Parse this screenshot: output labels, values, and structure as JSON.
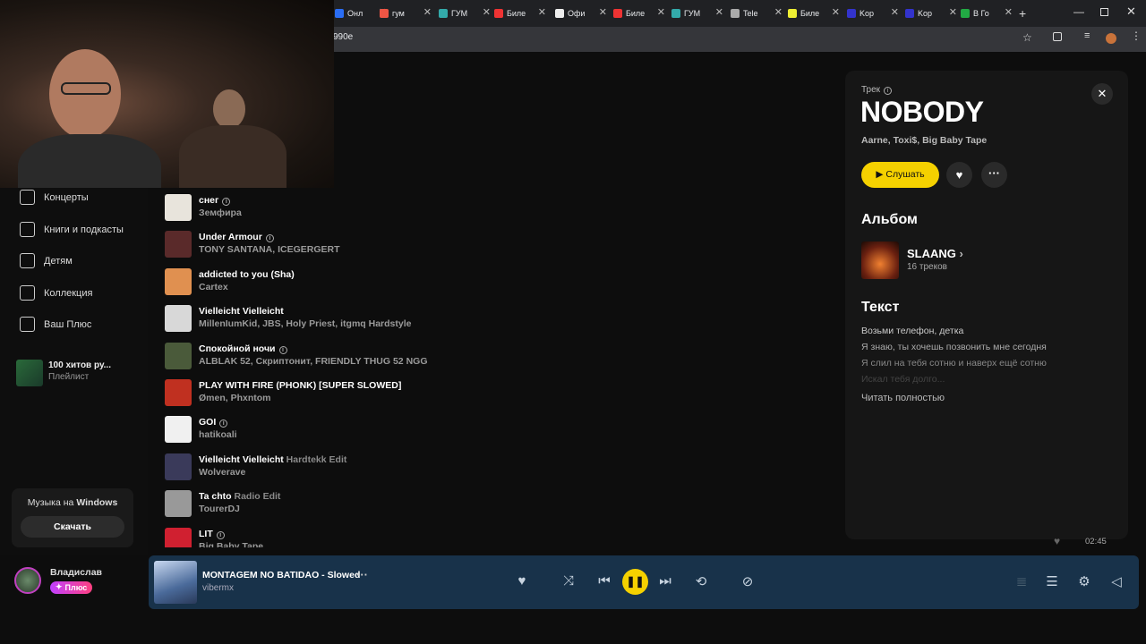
{
  "browser": {
    "tabs": [
      {
        "label": "Онл",
        "color": "#2a6df4"
      },
      {
        "label": "гум",
        "color": "#e54"
      },
      {
        "label": "ГУМ",
        "color": "#3aa"
      },
      {
        "label": "Биле",
        "color": "#e33"
      },
      {
        "label": "Офи",
        "color": "#eee"
      },
      {
        "label": "Биле",
        "color": "#e33"
      },
      {
        "label": "ГУМ",
        "color": "#3aa"
      },
      {
        "label": "Tele",
        "color": "#aaa"
      },
      {
        "label": "Биле",
        "color": "#ee3"
      },
      {
        "label": "Kop",
        "color": "#33c"
      },
      {
        "label": "Kop",
        "color": "#33c"
      },
      {
        "label": "В Го",
        "color": "#2a4"
      }
    ],
    "url": "990e"
  },
  "sidebar": {
    "items": [
      {
        "label": "Концерты",
        "icon": "tickets-icon"
      },
      {
        "label": "Книги и подкасты",
        "icon": "book-icon"
      },
      {
        "label": "Детям",
        "icon": "kids-icon"
      },
      {
        "label": "Коллекция",
        "icon": "heart-icon"
      },
      {
        "label": "Ваш Плюс",
        "icon": "plus-icon"
      }
    ],
    "playlist": {
      "title": "100 хитов ру...",
      "subtitle": "Плейлист"
    },
    "windows_card": {
      "text_prefix": "Музыка на",
      "text_brand": "Windows",
      "button": "Скачать"
    },
    "user": {
      "name": "Владислав",
      "badge": "Плюс"
    }
  },
  "tracks": [
    {
      "title": "снег",
      "extra": "",
      "artist": "Земфира",
      "info": true,
      "cover": "#e8e4dc"
    },
    {
      "title": "Under Armour",
      "extra": "",
      "artist": "TONY SANTANA, ICEGERGERT",
      "info": true,
      "cover": "#5a2a2a"
    },
    {
      "title": "addicted to you (Sha)",
      "extra": "",
      "artist": "Cartex",
      "info": false,
      "cover": "#e09050"
    },
    {
      "title": "Vielleicht Vielleicht",
      "extra": "",
      "artist": "MillenIumKid, JBS, Holy Priest, itgmq Hardstyle",
      "info": false,
      "cover": "#d8d8d8"
    },
    {
      "title": "Спокойной ночи",
      "extra": "",
      "artist": "ALBLAK 52, Скриптонит, FRIENDLY THUG 52 NGG",
      "info": true,
      "cover": "#4a5a3a"
    },
    {
      "title": "PLAY WITH FIRE (PHONK) [SUPER SLOWED]",
      "extra": "",
      "artist": "Ømen, Phxntom",
      "info": false,
      "cover": "#c03020"
    },
    {
      "title": "GOI",
      "extra": "",
      "artist": "hatikoali",
      "info": true,
      "cover": "#f0f0f0"
    },
    {
      "title": "Vielleicht Vielleicht",
      "extra": "Hardtekk Edit",
      "artist": "Wolverave",
      "info": false,
      "cover": "#3a3a5a"
    },
    {
      "title": "Ta chto",
      "extra": "Radio Edit",
      "artist": "TourerDJ",
      "info": false,
      "cover": "#999"
    },
    {
      "title": "LIT",
      "extra": "",
      "artist": "Big Baby Tape",
      "info": true,
      "cover": "#d02030"
    }
  ],
  "panel": {
    "kind": "Трек",
    "title": "NOBODY",
    "artists": "Aarne, Toxi$, Big Baby Tape",
    "listen": "Слушать",
    "album_heading": "Альбом",
    "album_title": "SLAANG",
    "album_tracks": "16 треков",
    "lyrics_heading": "Текст",
    "lyrics": [
      "Возьми телефон, детка",
      "Я знаю, ты хочешь позвонить мне сегодня",
      "Я слил на тебя сотню и наверх ещё сотню",
      "Искал тебя долго..."
    ],
    "read_more": "Читать полностью"
  },
  "player": {
    "title": "MONTAGEM NO BATIDAO - Slowed",
    "artist": "vibermx",
    "time": "02:45",
    "accent": "#f5d100"
  }
}
